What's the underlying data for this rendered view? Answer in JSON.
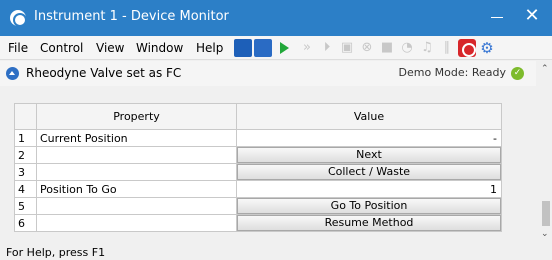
{
  "window": {
    "title": "Instrument 1 - Device Monitor",
    "close_glyph": "✕"
  },
  "menu": [
    "File",
    "Control",
    "View",
    "Window",
    "Help"
  ],
  "toolbar": {
    "icons": [
      "method-icon",
      "sequence-icon",
      "run-icon",
      "fast-forward-icon",
      "step-icon",
      "snapshot-icon",
      "abort-icon",
      "stop-icon",
      "pump-icon",
      "lamp-icon",
      "pause-icon",
      "alarm-icon",
      "settings-icon"
    ]
  },
  "panel": {
    "title": "Rheodyne Valve set as FC",
    "status": "Demo Mode: Ready",
    "status_color": "#7dbb2c"
  },
  "table": {
    "headers": [
      "Property",
      "Value"
    ],
    "rows": [
      {
        "num": "1",
        "property": "Current Position",
        "value": "-"
      },
      {
        "num": "2",
        "property": "",
        "button": "Next"
      },
      {
        "num": "3",
        "property": "",
        "button": "Collect / Waste"
      },
      {
        "num": "4",
        "property": "Position To Go",
        "value": "1"
      },
      {
        "num": "5",
        "property": "",
        "button": "Go To Position"
      },
      {
        "num": "6",
        "property": "",
        "button": "Resume Method"
      }
    ]
  },
  "statusbar": {
    "text": "For Help, press F1"
  },
  "colors": {
    "titlebar": "#2c7fc7",
    "accent": "#1d5fb8",
    "play": "#22a83a",
    "alarm": "#d7262a"
  }
}
